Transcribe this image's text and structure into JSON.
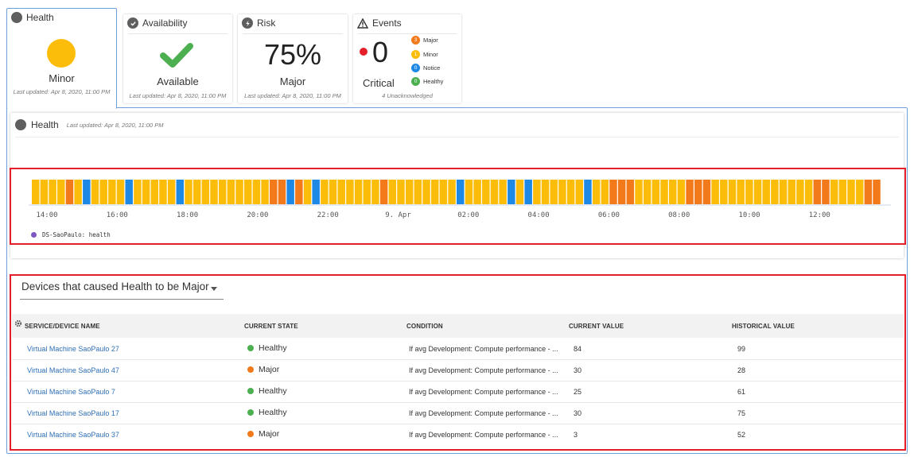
{
  "tabs": {
    "health": {
      "label": "Health",
      "value": "Minor",
      "updated": "Last updated: Apr 8, 2020, 11:00 PM",
      "color": "#fbbd09"
    },
    "availability": {
      "label": "Availability",
      "value": "Available",
      "updated": "Last updated: Apr 8, 2020, 11:00 PM",
      "color": "#4caf50"
    },
    "risk": {
      "label": "Risk",
      "value": "75%",
      "severity": "Major",
      "updated": "Last updated: Apr 8, 2020, 11:00 PM"
    },
    "events": {
      "label": "Events",
      "count": "0",
      "severity": "Critical",
      "unack": "4 Unacknowledged",
      "badges": [
        {
          "count": "3",
          "label": "Major",
          "color": "#f27a1a"
        },
        {
          "count": "1",
          "label": "Minor",
          "color": "#fbbd09"
        },
        {
          "count": "0",
          "label": "Notice",
          "color": "#1e88e5"
        },
        {
          "count": "0",
          "label": "Healthy",
          "color": "#4caf50"
        }
      ]
    }
  },
  "health_panel": {
    "title": "Health",
    "updated": "Last updated: Apr 8, 2020, 11:00 PM",
    "legend": "DS-SaoPaulo: health",
    "legend_color": "#7e57c2"
  },
  "chart_data": {
    "type": "bar",
    "series": [
      {
        "name": "DS-SaoPaulo: health"
      }
    ],
    "x_ticks": [
      "14:00",
      "16:00",
      "18:00",
      "20:00",
      "22:00",
      "9. Apr",
      "02:00",
      "04:00",
      "06:00",
      "08:00",
      "10:00",
      "12:00"
    ],
    "state_colors": {
      "Minor": "#fbbd09",
      "Major": "#f27a1a",
      "Notice": "#1e88e5"
    },
    "states": [
      "Minor",
      "Minor",
      "Minor",
      "Minor",
      "Major",
      "Minor",
      "Notice",
      "Minor",
      "Minor",
      "Minor",
      "Minor",
      "Notice",
      "Minor",
      "Minor",
      "Minor",
      "Minor",
      "Minor",
      "Notice",
      "Minor",
      "Minor",
      "Minor",
      "Minor",
      "Minor",
      "Minor",
      "Minor",
      "Minor",
      "Minor",
      "Minor",
      "Major",
      "Major",
      "Notice",
      "Major",
      "Minor",
      "Notice",
      "Minor",
      "Minor",
      "Minor",
      "Minor",
      "Minor",
      "Minor",
      "Minor",
      "Major",
      "Minor",
      "Minor",
      "Minor",
      "Minor",
      "Minor",
      "Minor",
      "Minor",
      "Minor",
      "Notice",
      "Minor",
      "Minor",
      "Minor",
      "Minor",
      "Minor",
      "Notice",
      "Minor",
      "Notice",
      "Minor",
      "Minor",
      "Minor",
      "Minor",
      "Minor",
      "Minor",
      "Notice",
      "Minor",
      "Minor",
      "Major",
      "Major",
      "Major",
      "Minor",
      "Minor",
      "Minor",
      "Minor",
      "Minor",
      "Minor",
      "Major",
      "Major",
      "Major",
      "Minor",
      "Minor",
      "Minor",
      "Minor",
      "Minor",
      "Minor",
      "Minor",
      "Minor",
      "Minor",
      "Minor",
      "Minor",
      "Minor",
      "Major",
      "Major",
      "Minor",
      "Minor",
      "Minor",
      "Minor",
      "Major",
      "Major"
    ]
  },
  "devices": {
    "dropdown": "Devices that caused Health to be Major",
    "columns": [
      "SERVICE/DEVICE NAME",
      "CURRENT STATE",
      "CONDITION",
      "CURRENT VALUE",
      "HISTORICAL VALUE"
    ],
    "rows": [
      {
        "name": "Virtual Machine SaoPaulo 27",
        "state": "Healthy",
        "state_color": "#4caf50",
        "condition": "If avg Development: Compute performance - ...",
        "current": "84",
        "historical": "99"
      },
      {
        "name": "Virtual Machine SaoPaulo 47",
        "state": "Major",
        "state_color": "#f27a1a",
        "condition": "If avg Development: Compute performance - ...",
        "current": "30",
        "historical": "28"
      },
      {
        "name": "Virtual Machine SaoPaulo 7",
        "state": "Healthy",
        "state_color": "#4caf50",
        "condition": "If avg Development: Compute performance - ...",
        "current": "25",
        "historical": "61"
      },
      {
        "name": "Virtual Machine SaoPaulo 17",
        "state": "Healthy",
        "state_color": "#4caf50",
        "condition": "If avg Development: Compute performance - ...",
        "current": "30",
        "historical": "75"
      },
      {
        "name": "Virtual Machine SaoPaulo 37",
        "state": "Major",
        "state_color": "#f27a1a",
        "condition": "If avg Development: Compute performance - ...",
        "current": "3",
        "historical": "52"
      }
    ]
  }
}
